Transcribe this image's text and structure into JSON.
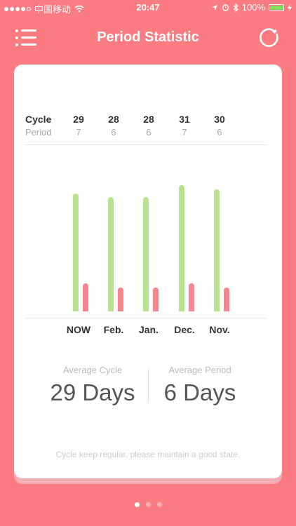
{
  "status_bar": {
    "carrier": "中国移动",
    "time": "20:47",
    "battery": "100%"
  },
  "header": {
    "title": "Period Statistic",
    "menu_icon": "list-icon",
    "refresh_icon": "refresh-heart-icon"
  },
  "stats": {
    "cycle_label": "Cycle",
    "period_label": "Period",
    "months": [
      "NOW",
      "Feb.",
      "Jan.",
      "Dec.",
      "Nov."
    ],
    "cycle_values": [
      29,
      28,
      28,
      31,
      30
    ],
    "period_values": [
      7,
      6,
      6,
      7,
      6
    ]
  },
  "chart_data": {
    "type": "bar",
    "categories": [
      "NOW",
      "Feb.",
      "Jan.",
      "Dec.",
      "Nov."
    ],
    "series": [
      {
        "name": "Cycle",
        "values": [
          29,
          28,
          28,
          31,
          30
        ],
        "color": "#b8e38e"
      },
      {
        "name": "Period",
        "values": [
          7,
          6,
          6,
          7,
          6
        ],
        "color": "#f7848e"
      }
    ],
    "xlabel": "",
    "ylabel": ""
  },
  "averages": {
    "cycle_title": "Average Cycle",
    "cycle_value": "29 Days",
    "period_title": "Average Period",
    "period_value": "6 Days"
  },
  "footer": {
    "note": "Cycle keep regular, please maintain a good state."
  },
  "pager": {
    "count": 3,
    "active": 0
  },
  "colors": {
    "background": "#fa7b82",
    "cycle_bar": "#b8e38e",
    "period_bar": "#f7848e"
  }
}
